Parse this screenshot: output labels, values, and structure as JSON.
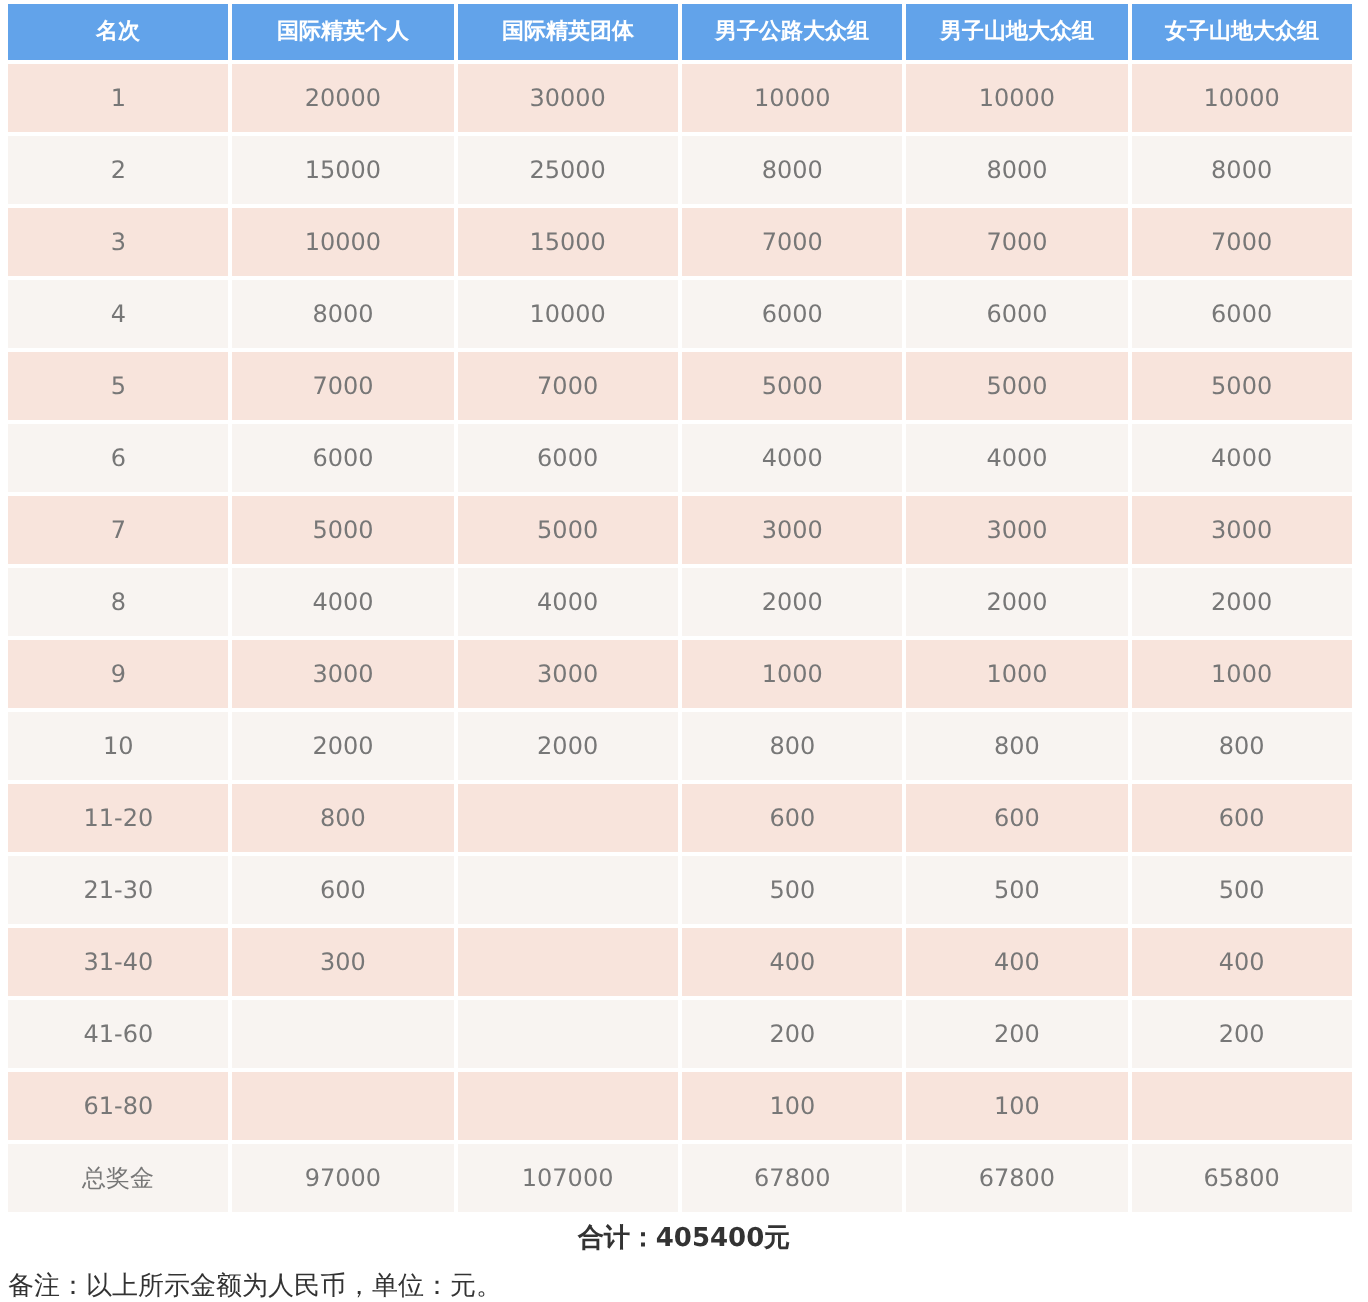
{
  "table": {
    "columns": [
      "名次",
      "国际精英个人",
      "国际精英团体",
      "男子公路大众组",
      "男子山地大众组",
      "女子山地大众组"
    ],
    "rows": [
      [
        "1",
        "20000",
        "30000",
        "10000",
        "10000",
        "10000"
      ],
      [
        "2",
        "15000",
        "25000",
        "8000",
        "8000",
        "8000"
      ],
      [
        "3",
        "10000",
        "15000",
        "7000",
        "7000",
        "7000"
      ],
      [
        "4",
        "8000",
        "10000",
        "6000",
        "6000",
        "6000"
      ],
      [
        "5",
        "7000",
        "7000",
        "5000",
        "5000",
        "5000"
      ],
      [
        "6",
        "6000",
        "6000",
        "4000",
        "4000",
        "4000"
      ],
      [
        "7",
        "5000",
        "5000",
        "3000",
        "3000",
        "3000"
      ],
      [
        "8",
        "4000",
        "4000",
        "2000",
        "2000",
        "2000"
      ],
      [
        "9",
        "3000",
        "3000",
        "1000",
        "1000",
        "1000"
      ],
      [
        "10",
        "2000",
        "2000",
        "800",
        "800",
        "800"
      ],
      [
        "11-20",
        "800",
        null,
        "600",
        "600",
        "600"
      ],
      [
        "21-30",
        "600",
        null,
        "500",
        "500",
        "500"
      ],
      [
        "31-40",
        "300",
        null,
        "400",
        "400",
        "400"
      ],
      [
        "41-60",
        null,
        null,
        "200",
        "200",
        "200"
      ],
      [
        "61-80",
        null,
        null,
        "100",
        "100",
        null
      ],
      [
        "总奖金",
        "97000",
        "107000",
        "67800",
        "67800",
        "65800"
      ]
    ]
  },
  "total": {
    "label": "合计：",
    "amount": "405400元"
  },
  "note": "备注：以上所示金额为人民币，单位：元。"
}
